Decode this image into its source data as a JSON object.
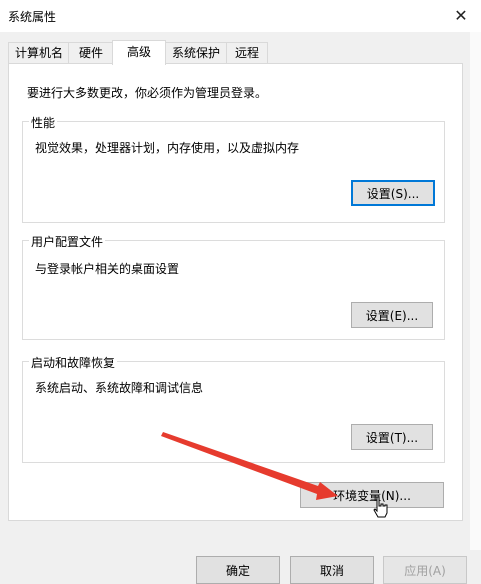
{
  "window": {
    "title": "系统属性"
  },
  "tabs": [
    {
      "label": "计算机名"
    },
    {
      "label": "硬件"
    },
    {
      "label": "高级"
    },
    {
      "label": "系统保护"
    },
    {
      "label": "远程"
    }
  ],
  "notice": "要进行大多数更改，你必须作为管理员登录。",
  "groups": {
    "performance": {
      "title": "性能",
      "desc": "视觉效果，处理器计划，内存使用，以及虚拟内存",
      "button": "设置(S)..."
    },
    "profiles": {
      "title": "用户配置文件",
      "desc": "与登录帐户相关的桌面设置",
      "button": "设置(E)..."
    },
    "startup": {
      "title": "启动和故障恢复",
      "desc": "系统启动、系统故障和调试信息",
      "button": "设置(T)..."
    }
  },
  "env_button": "环境变量(N)...",
  "dialog_buttons": {
    "ok": "确定",
    "cancel": "取消",
    "apply": "应用(A)"
  },
  "colors": {
    "focus": "#0078d7",
    "arrow": "#e63b2e"
  }
}
